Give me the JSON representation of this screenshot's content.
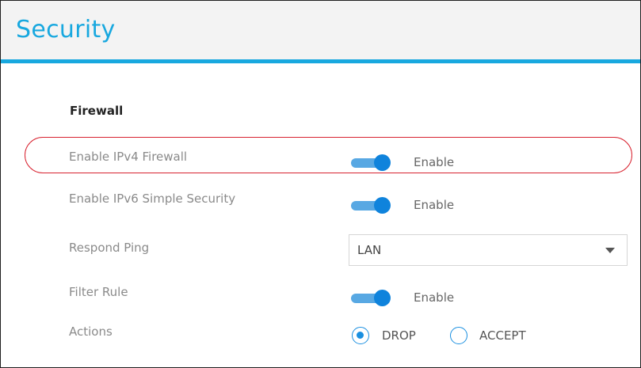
{
  "header": {
    "title": "Security"
  },
  "firewall": {
    "section_title": "Firewall",
    "rows": {
      "ipv4": {
        "label": "Enable IPv4 Firewall",
        "state_label": "Enable",
        "enabled": true
      },
      "ipv6": {
        "label": "Enable IPv6 Simple Security",
        "state_label": "Enable",
        "enabled": true
      },
      "respond_ping": {
        "label": "Respond Ping",
        "selected": "LAN"
      },
      "filter_rule": {
        "label": "Filter Rule",
        "state_label": "Enable",
        "enabled": true
      },
      "actions": {
        "label": "Actions",
        "options": [
          "DROP",
          "ACCEPT"
        ],
        "selected": "DROP"
      }
    }
  },
  "colors": {
    "accent": "#18a8df",
    "toggle_on": "#0f83dc",
    "highlight": "#d82330"
  }
}
